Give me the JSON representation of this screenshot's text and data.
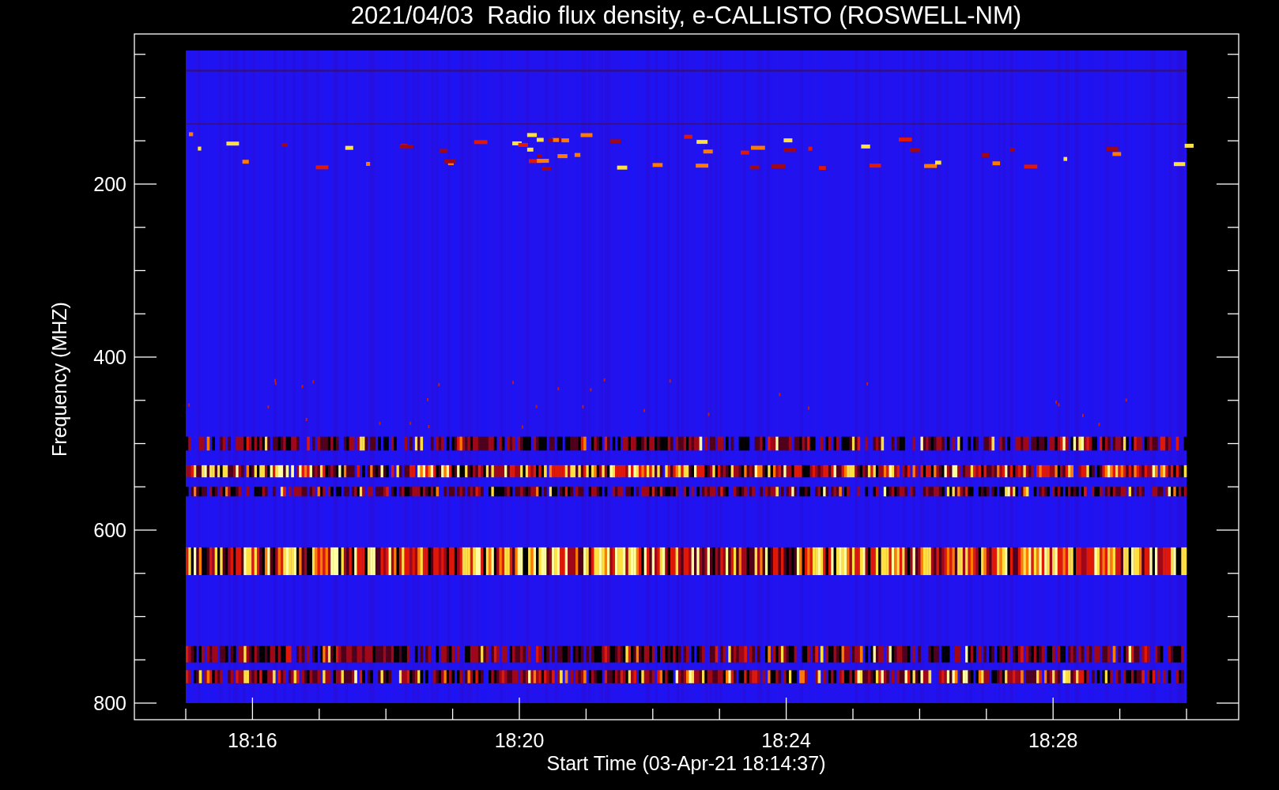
{
  "title": "2021/04/03  Radio flux density, e-CALLISTO (ROSWELL-NM)",
  "xlabel": "Start Time (03-Apr-21 18:14:37)",
  "ylabel": "Frequency (MHZ)",
  "yticks": [
    "200",
    "400",
    "600",
    "800"
  ],
  "xticks": [
    "18:16",
    "18:20",
    "18:24",
    "18:28"
  ]
}
